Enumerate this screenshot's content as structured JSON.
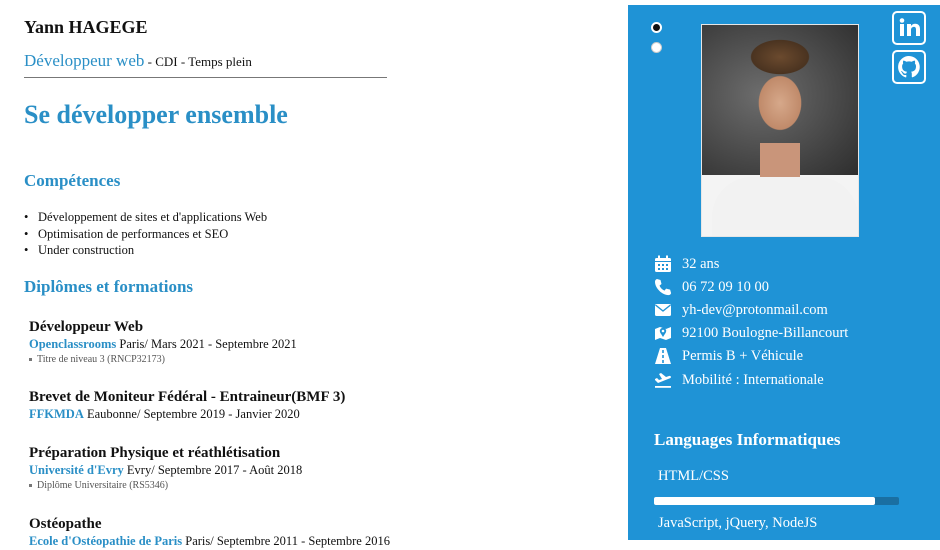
{
  "header": {
    "name": "Yann HAGEGE",
    "job_title": "Développeur web",
    "job_type": " - CDI - Temps plein",
    "slogan": "Se développer ensemble"
  },
  "skills": {
    "title": "Compétences",
    "items": [
      "Développement de sites et d'applications Web",
      "Optimisation de performances et SEO",
      "Under construction"
    ]
  },
  "education": {
    "title": "Diplômes et formations",
    "items": [
      {
        "title": "Développeur Web",
        "school": "Openclassrooms",
        "details": " Paris/ Mars 2021 - Septembre 2021",
        "note": "Titre de niveau 3 (RNCP32173)"
      },
      {
        "title": "Brevet de Moniteur Fédéral - Entraineur(BMF 3)",
        "school": "FFKMDA",
        "details": " Eaubonne/ Septembre 2019 - Janvier 2020",
        "note": ""
      },
      {
        "title": "Préparation Physique et réathlétisation",
        "school": "Université d'Evry",
        "details": " Evry/ Septembre 2017 - Août 2018",
        "note": "Diplôme Universitaire (RS5346)"
      },
      {
        "title": "Ostéopathe",
        "school": "Ecole d'Ostéopathie de Paris",
        "details": " Paris/ Septembre 2011 - Septembre 2016",
        "note": ""
      }
    ]
  },
  "sidebar": {
    "info": [
      {
        "icon": "calendar-icon",
        "text": "32 ans"
      },
      {
        "icon": "phone-icon",
        "text": "06 72 09 10 00"
      },
      {
        "icon": "envelope-icon",
        "text": "yh-dev@protonmail.com"
      },
      {
        "icon": "map-icon",
        "text": "92100 Boulogne-Billancourt"
      },
      {
        "icon": "road-icon",
        "text": "Permis B + Véhicule"
      },
      {
        "icon": "plane-icon",
        "text": "Mobilité : Internationale"
      }
    ],
    "languages_title": "Languages Informatiques",
    "languages": [
      {
        "label": "HTML/CSS",
        "level": 0.9
      },
      {
        "label": "JavaScript, jQuery, NodeJS",
        "level": 0
      }
    ],
    "social": [
      "linkedin-icon",
      "github-icon"
    ]
  },
  "colors": {
    "accent": "#1f93d6",
    "title_blue": "#2a8fc6"
  }
}
